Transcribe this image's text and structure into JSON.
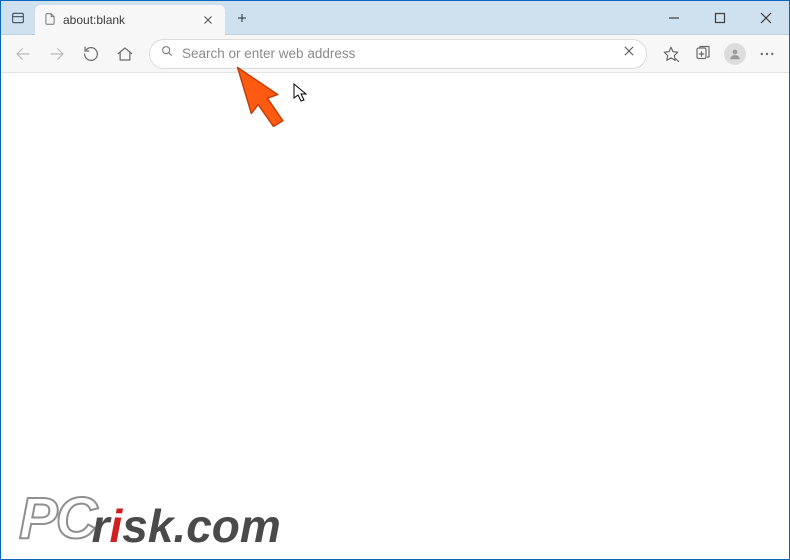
{
  "titlebar": {
    "tabpanel_icon": "tab-preview-icon",
    "tabs": [
      {
        "title": "about:blank"
      }
    ],
    "newtab_label": "+"
  },
  "window_controls": {
    "minimize": "minimize",
    "maximize": "maximize",
    "close": "close"
  },
  "toolbar": {
    "back": "Back",
    "forward": "Forward",
    "refresh": "Refresh",
    "home": "Home",
    "addressbar": {
      "placeholder": "Search or enter web address",
      "value": ""
    },
    "right": {
      "favorites": "Favorites",
      "collections": "Collections",
      "profile": "Profile",
      "more": "Settings and more"
    }
  },
  "overlay": {
    "arrow_color": "#ff5a12"
  },
  "watermark": {
    "big": "PC",
    "rest_prefix": "r",
    "rest_red": "i",
    "rest_suffix": "sk.com"
  }
}
